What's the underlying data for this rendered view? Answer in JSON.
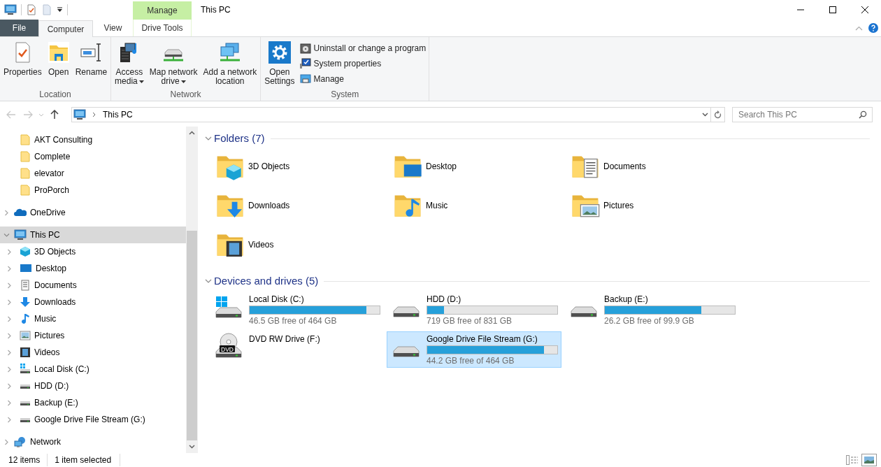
{
  "title_bar": {
    "title": "This PC",
    "contextual_group": "Manage"
  },
  "tabs": [
    {
      "label": "File",
      "kind": "file",
      "selected": false
    },
    {
      "label": "Computer",
      "kind": "standard",
      "selected": true
    },
    {
      "label": "View",
      "kind": "standard",
      "selected": false
    },
    {
      "label": "Drive Tools",
      "kind": "contextual",
      "selected": false
    }
  ],
  "ribbon": {
    "groups": [
      {
        "label": "Location",
        "buttons": [
          {
            "label": "Properties",
            "kind": "properties",
            "dropdown": false
          },
          {
            "label": "Open",
            "kind": "open",
            "dropdown": false
          },
          {
            "label": "Rename",
            "kind": "rename",
            "dropdown": false
          }
        ]
      },
      {
        "label": "Network",
        "buttons": [
          {
            "label": "Access\nmedia",
            "kind": "media",
            "dropdown": true
          },
          {
            "label": "Map network\ndrive",
            "kind": "mapdrive",
            "dropdown": true
          },
          {
            "label": "Add a network\nlocation",
            "kind": "addnet",
            "dropdown": false
          }
        ]
      },
      {
        "label": "System",
        "buttons": [
          {
            "label": "Open\nSettings",
            "kind": "settings",
            "dropdown": false
          },
          {
            "label": "Uninstall or change a program",
            "kind": "uninstall",
            "dropdown": false
          },
          {
            "label": "System properties",
            "kind": "sysprops",
            "dropdown": false
          },
          {
            "label": "Manage",
            "kind": "manage",
            "dropdown": false
          }
        ]
      }
    ]
  },
  "navigation": {
    "back": {
      "disabled": true
    },
    "forward": {
      "disabled": true
    },
    "up": {
      "disabled": false
    }
  },
  "address": {
    "location": "This PC",
    "search_placeholder": "Search This PC"
  },
  "sidebar": {
    "pinned": [
      {
        "label": "AKT Consulting",
        "selected": false
      },
      {
        "label": "Complete",
        "selected": false
      },
      {
        "label": "elevator",
        "selected": false
      },
      {
        "label": "ProPorch",
        "selected": false
      }
    ],
    "tree": [
      {
        "label": "OneDrive",
        "kind": "onedrive",
        "expanded": false,
        "selected": false
      },
      {
        "label": "This PC",
        "kind": "pc",
        "expanded": true,
        "selected": true,
        "children": [
          {
            "label": "3D Objects",
            "kind": "objects",
            "expanded": false,
            "selected": false
          },
          {
            "label": "Desktop",
            "kind": "desktop",
            "expanded": false,
            "selected": false
          },
          {
            "label": "Documents",
            "kind": "documents",
            "expanded": false,
            "selected": false
          },
          {
            "label": "Downloads",
            "kind": "downloads",
            "expanded": false,
            "selected": false
          },
          {
            "label": "Music",
            "kind": "music",
            "expanded": false,
            "selected": false
          },
          {
            "label": "Pictures",
            "kind": "pictures",
            "expanded": false,
            "selected": false
          },
          {
            "label": "Videos",
            "kind": "videos",
            "expanded": false,
            "selected": false
          },
          {
            "label": "Local Disk (C:)",
            "kind": "system",
            "expanded": false,
            "selected": false
          },
          {
            "label": "HDD (D:)",
            "kind": "hdd",
            "expanded": false,
            "selected": false
          },
          {
            "label": "Backup (E:)",
            "kind": "hdd",
            "expanded": false,
            "selected": false
          },
          {
            "label": "Google Drive File Stream (G:)",
            "kind": "hdd",
            "expanded": false,
            "selected": false
          }
        ]
      },
      {
        "label": "Network",
        "kind": "network",
        "expanded": false,
        "selected": false
      }
    ]
  },
  "content": {
    "sections": [
      {
        "title": "Folders (7)",
        "kind": "folders",
        "expanded": true,
        "items": [
          {
            "label": "3D Objects",
            "kind": "objects",
            "selected": false
          },
          {
            "label": "Desktop",
            "kind": "desktop",
            "selected": false
          },
          {
            "label": "Documents",
            "kind": "documents",
            "selected": false
          },
          {
            "label": "Downloads",
            "kind": "downloads",
            "selected": false
          },
          {
            "label": "Music",
            "kind": "music",
            "selected": false
          },
          {
            "label": "Pictures",
            "kind": "pictures",
            "selected": false
          },
          {
            "label": "Videos",
            "kind": "videos",
            "selected": false
          }
        ]
      },
      {
        "title": "Devices and drives (5)",
        "kind": "drives",
        "expanded": true,
        "items": [
          {
            "label": "Local Disk (C:)",
            "kind": "system",
            "level": 0.9,
            "free": "46.5 GB free of 464 GB",
            "selected": false
          },
          {
            "label": "HDD (D:)",
            "kind": "hdd",
            "level": 0.13,
            "free": "719 GB free of 831 GB",
            "selected": false
          },
          {
            "label": "Backup (E:)",
            "kind": "hdd",
            "level": 0.74,
            "free": "26.2 GB free of 99.9 GB",
            "selected": false
          },
          {
            "label": "DVD RW Drive (F:)",
            "kind": "dvd",
            "icon_label": "DVD",
            "selected": false
          },
          {
            "label": "Google Drive File Stream (G:)",
            "kind": "hdd",
            "level": 0.9,
            "free": "44.2 GB free of 464 GB",
            "selected": true
          }
        ]
      }
    ]
  },
  "status_bar": {
    "item_count": "12 items",
    "selection": "1 item selected",
    "views": [
      {
        "kind": "details",
        "selected": false
      },
      {
        "kind": "large_icons",
        "selected": true
      }
    ]
  }
}
